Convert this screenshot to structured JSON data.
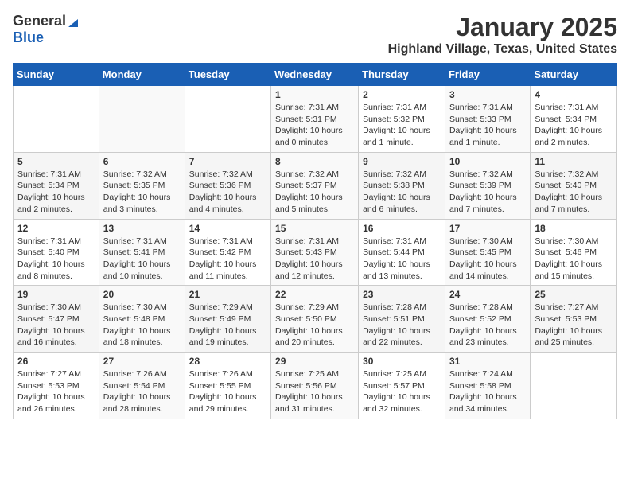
{
  "header": {
    "logo_general": "General",
    "logo_blue": "Blue",
    "month": "January 2025",
    "location": "Highland Village, Texas, United States"
  },
  "weekdays": [
    "Sunday",
    "Monday",
    "Tuesday",
    "Wednesday",
    "Thursday",
    "Friday",
    "Saturday"
  ],
  "weeks": [
    [
      {
        "day": "",
        "sunrise": "",
        "sunset": "",
        "daylight": ""
      },
      {
        "day": "",
        "sunrise": "",
        "sunset": "",
        "daylight": ""
      },
      {
        "day": "",
        "sunrise": "",
        "sunset": "",
        "daylight": ""
      },
      {
        "day": "1",
        "sunrise": "Sunrise: 7:31 AM",
        "sunset": "Sunset: 5:31 PM",
        "daylight": "Daylight: 10 hours and 0 minutes."
      },
      {
        "day": "2",
        "sunrise": "Sunrise: 7:31 AM",
        "sunset": "Sunset: 5:32 PM",
        "daylight": "Daylight: 10 hours and 1 minute."
      },
      {
        "day": "3",
        "sunrise": "Sunrise: 7:31 AM",
        "sunset": "Sunset: 5:33 PM",
        "daylight": "Daylight: 10 hours and 1 minute."
      },
      {
        "day": "4",
        "sunrise": "Sunrise: 7:31 AM",
        "sunset": "Sunset: 5:34 PM",
        "daylight": "Daylight: 10 hours and 2 minutes."
      }
    ],
    [
      {
        "day": "5",
        "sunrise": "Sunrise: 7:31 AM",
        "sunset": "Sunset: 5:34 PM",
        "daylight": "Daylight: 10 hours and 2 minutes."
      },
      {
        "day": "6",
        "sunrise": "Sunrise: 7:32 AM",
        "sunset": "Sunset: 5:35 PM",
        "daylight": "Daylight: 10 hours and 3 minutes."
      },
      {
        "day": "7",
        "sunrise": "Sunrise: 7:32 AM",
        "sunset": "Sunset: 5:36 PM",
        "daylight": "Daylight: 10 hours and 4 minutes."
      },
      {
        "day": "8",
        "sunrise": "Sunrise: 7:32 AM",
        "sunset": "Sunset: 5:37 PM",
        "daylight": "Daylight: 10 hours and 5 minutes."
      },
      {
        "day": "9",
        "sunrise": "Sunrise: 7:32 AM",
        "sunset": "Sunset: 5:38 PM",
        "daylight": "Daylight: 10 hours and 6 minutes."
      },
      {
        "day": "10",
        "sunrise": "Sunrise: 7:32 AM",
        "sunset": "Sunset: 5:39 PM",
        "daylight": "Daylight: 10 hours and 7 minutes."
      },
      {
        "day": "11",
        "sunrise": "Sunrise: 7:32 AM",
        "sunset": "Sunset: 5:40 PM",
        "daylight": "Daylight: 10 hours and 7 minutes."
      }
    ],
    [
      {
        "day": "12",
        "sunrise": "Sunrise: 7:31 AM",
        "sunset": "Sunset: 5:40 PM",
        "daylight": "Daylight: 10 hours and 8 minutes."
      },
      {
        "day": "13",
        "sunrise": "Sunrise: 7:31 AM",
        "sunset": "Sunset: 5:41 PM",
        "daylight": "Daylight: 10 hours and 10 minutes."
      },
      {
        "day": "14",
        "sunrise": "Sunrise: 7:31 AM",
        "sunset": "Sunset: 5:42 PM",
        "daylight": "Daylight: 10 hours and 11 minutes."
      },
      {
        "day": "15",
        "sunrise": "Sunrise: 7:31 AM",
        "sunset": "Sunset: 5:43 PM",
        "daylight": "Daylight: 10 hours and 12 minutes."
      },
      {
        "day": "16",
        "sunrise": "Sunrise: 7:31 AM",
        "sunset": "Sunset: 5:44 PM",
        "daylight": "Daylight: 10 hours and 13 minutes."
      },
      {
        "day": "17",
        "sunrise": "Sunrise: 7:30 AM",
        "sunset": "Sunset: 5:45 PM",
        "daylight": "Daylight: 10 hours and 14 minutes."
      },
      {
        "day": "18",
        "sunrise": "Sunrise: 7:30 AM",
        "sunset": "Sunset: 5:46 PM",
        "daylight": "Daylight: 10 hours and 15 minutes."
      }
    ],
    [
      {
        "day": "19",
        "sunrise": "Sunrise: 7:30 AM",
        "sunset": "Sunset: 5:47 PM",
        "daylight": "Daylight: 10 hours and 16 minutes."
      },
      {
        "day": "20",
        "sunrise": "Sunrise: 7:30 AM",
        "sunset": "Sunset: 5:48 PM",
        "daylight": "Daylight: 10 hours and 18 minutes."
      },
      {
        "day": "21",
        "sunrise": "Sunrise: 7:29 AM",
        "sunset": "Sunset: 5:49 PM",
        "daylight": "Daylight: 10 hours and 19 minutes."
      },
      {
        "day": "22",
        "sunrise": "Sunrise: 7:29 AM",
        "sunset": "Sunset: 5:50 PM",
        "daylight": "Daylight: 10 hours and 20 minutes."
      },
      {
        "day": "23",
        "sunrise": "Sunrise: 7:28 AM",
        "sunset": "Sunset: 5:51 PM",
        "daylight": "Daylight: 10 hours and 22 minutes."
      },
      {
        "day": "24",
        "sunrise": "Sunrise: 7:28 AM",
        "sunset": "Sunset: 5:52 PM",
        "daylight": "Daylight: 10 hours and 23 minutes."
      },
      {
        "day": "25",
        "sunrise": "Sunrise: 7:27 AM",
        "sunset": "Sunset: 5:53 PM",
        "daylight": "Daylight: 10 hours and 25 minutes."
      }
    ],
    [
      {
        "day": "26",
        "sunrise": "Sunrise: 7:27 AM",
        "sunset": "Sunset: 5:53 PM",
        "daylight": "Daylight: 10 hours and 26 minutes."
      },
      {
        "day": "27",
        "sunrise": "Sunrise: 7:26 AM",
        "sunset": "Sunset: 5:54 PM",
        "daylight": "Daylight: 10 hours and 28 minutes."
      },
      {
        "day": "28",
        "sunrise": "Sunrise: 7:26 AM",
        "sunset": "Sunset: 5:55 PM",
        "daylight": "Daylight: 10 hours and 29 minutes."
      },
      {
        "day": "29",
        "sunrise": "Sunrise: 7:25 AM",
        "sunset": "Sunset: 5:56 PM",
        "daylight": "Daylight: 10 hours and 31 minutes."
      },
      {
        "day": "30",
        "sunrise": "Sunrise: 7:25 AM",
        "sunset": "Sunset: 5:57 PM",
        "daylight": "Daylight: 10 hours and 32 minutes."
      },
      {
        "day": "31",
        "sunrise": "Sunrise: 7:24 AM",
        "sunset": "Sunset: 5:58 PM",
        "daylight": "Daylight: 10 hours and 34 minutes."
      },
      {
        "day": "",
        "sunrise": "",
        "sunset": "",
        "daylight": ""
      }
    ]
  ]
}
